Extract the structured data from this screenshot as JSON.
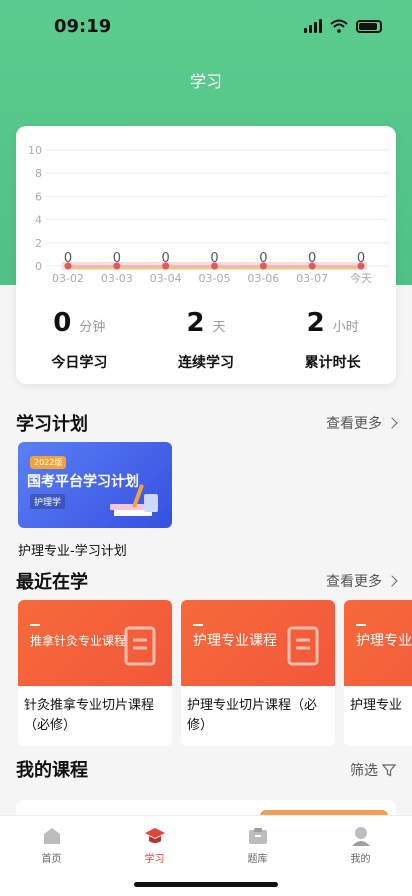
{
  "status_bar": {
    "time": "09:19"
  },
  "header": {
    "title": "学习"
  },
  "chart_data": {
    "type": "line",
    "categories": [
      "03-02",
      "03-03",
      "03-04",
      "03-05",
      "03-06",
      "03-07",
      "今天"
    ],
    "values": [
      0,
      0,
      0,
      0,
      0,
      0,
      0
    ],
    "ylim": [
      0,
      10
    ],
    "yticks": [
      0,
      2,
      4,
      6,
      8,
      10
    ],
    "grid": true,
    "colors": {
      "line": "#e9b4d8",
      "point": "#e05a5a",
      "band": "#f7d7cf",
      "band_line": "#f2c24a"
    }
  },
  "stats": [
    {
      "value": "0",
      "unit": "分钟",
      "label": "今日学习"
    },
    {
      "value": "2",
      "unit": "天",
      "label": "连续学习"
    },
    {
      "value": "2",
      "unit": "小时",
      "label": "累计时长"
    }
  ],
  "plan": {
    "title": "学习计划",
    "more": "查看更多",
    "card": {
      "year": "2022版",
      "name": "国考平台学习计划",
      "tag": "护理学"
    },
    "caption": "护理专业-学习计划"
  },
  "recent": {
    "title": "最近在学",
    "more": "查看更多",
    "items": [
      {
        "img_title": "推拿针灸专业课程",
        "caption": "针灸推拿专业切片课程（必修）"
      },
      {
        "img_title": "护理专业课程",
        "caption": "护理专业切片课程（必修）"
      },
      {
        "img_title": "护理专业课程",
        "caption": "护理专业"
      }
    ]
  },
  "my_courses": {
    "title": "我的课程",
    "filter": "筛选"
  },
  "tabbar": {
    "items": [
      {
        "label": "首页",
        "icon": "home-icon",
        "active": false
      },
      {
        "label": "学习",
        "icon": "graduation-cap-icon",
        "active": true
      },
      {
        "label": "题库",
        "icon": "question-bank-icon",
        "active": false
      },
      {
        "label": "我的",
        "icon": "profile-icon",
        "active": false
      }
    ]
  },
  "colors": {
    "brand_green": "#55c78a",
    "active_red": "#e0463c",
    "course_orange": "#f4633a",
    "plan_blue": "#4a69ee"
  }
}
